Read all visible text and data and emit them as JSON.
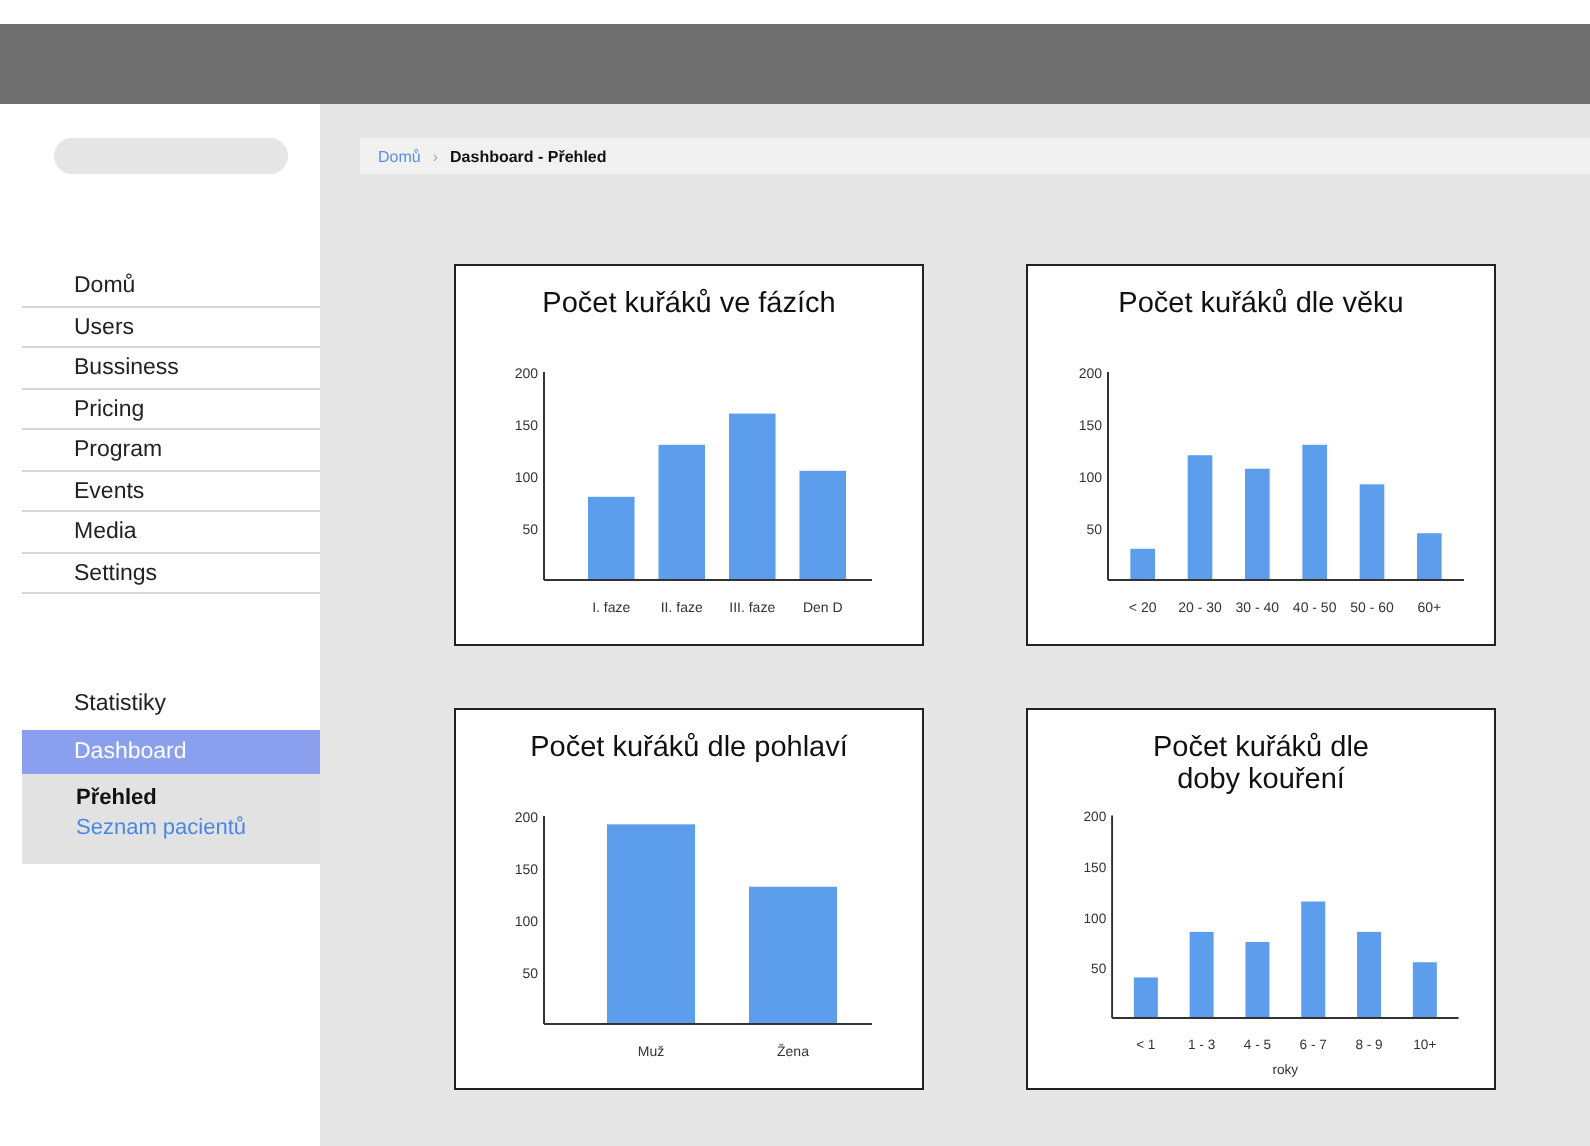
{
  "sidebar": {
    "nav_items": [
      {
        "label": "Domů"
      },
      {
        "label": "Users"
      },
      {
        "label": "Bussiness"
      },
      {
        "label": "Pricing"
      },
      {
        "label": "Program"
      },
      {
        "label": "Events"
      },
      {
        "label": "Media"
      },
      {
        "label": "Settings"
      }
    ],
    "section": {
      "title": "Statistiky",
      "items": [
        {
          "label": "Dashboard",
          "selected": true,
          "expanded": true,
          "children": [
            {
              "label": "Přehled",
              "selected": true
            },
            {
              "label": "Seznam pacientů",
              "selected": false
            }
          ]
        }
      ]
    }
  },
  "breadcrumb": {
    "items": [
      "Domů",
      "Dashboard - Přehled"
    ],
    "separator": "›"
  },
  "charts": [
    {
      "chart_data": {
        "type": "bar",
        "title": "Počet kuřáků ve fázích",
        "categories": [
          "I. faze",
          "II. faze",
          "III. faze",
          "Den D"
        ],
        "series": [
          {
            "color": "#5c9eec",
            "values": [
              80,
              130,
              160,
              105
            ]
          }
        ],
        "ylim": [
          0,
          200
        ],
        "yticks": [
          50,
          100,
          150,
          200
        ]
      }
    },
    {
      "chart_data": {
        "type": "bar",
        "title": "Počet kuřáků dle věku",
        "categories": [
          "< 20",
          "20 - 30",
          "30 - 40",
          "40 - 50",
          "50 - 60",
          "60+"
        ],
        "series": [
          {
            "color": "#5c9eec",
            "values": [
              30,
              120,
              107,
              130,
              92,
              45
            ]
          }
        ],
        "ylim": [
          0,
          200
        ],
        "yticks": [
          50,
          100,
          150,
          200
        ]
      }
    },
    {
      "chart_data": {
        "type": "bar",
        "title": "Počet kuřáků dle pohlaví",
        "categories": [
          "Muž",
          "Žena"
        ],
        "series": [
          {
            "color": "#5c9eec",
            "values": [
              192,
              132
            ]
          }
        ],
        "ylim": [
          0,
          200
        ],
        "yticks": [
          50,
          100,
          150,
          200
        ]
      }
    },
    {
      "chart_data": {
        "type": "bar",
        "title": "Počet kuřáků dle\ndoby kouření",
        "xlabel": "roky",
        "categories": [
          "< 1",
          "1 - 3",
          "4 - 5",
          "6 - 7",
          "8 - 9",
          "10+"
        ],
        "series": [
          {
            "color": "#5c9eec",
            "values": [
              40,
              85,
              75,
              115,
              85,
              55
            ]
          }
        ],
        "ylim": [
          0,
          200
        ],
        "yticks": [
          50,
          100,
          150,
          200
        ]
      }
    }
  ]
}
